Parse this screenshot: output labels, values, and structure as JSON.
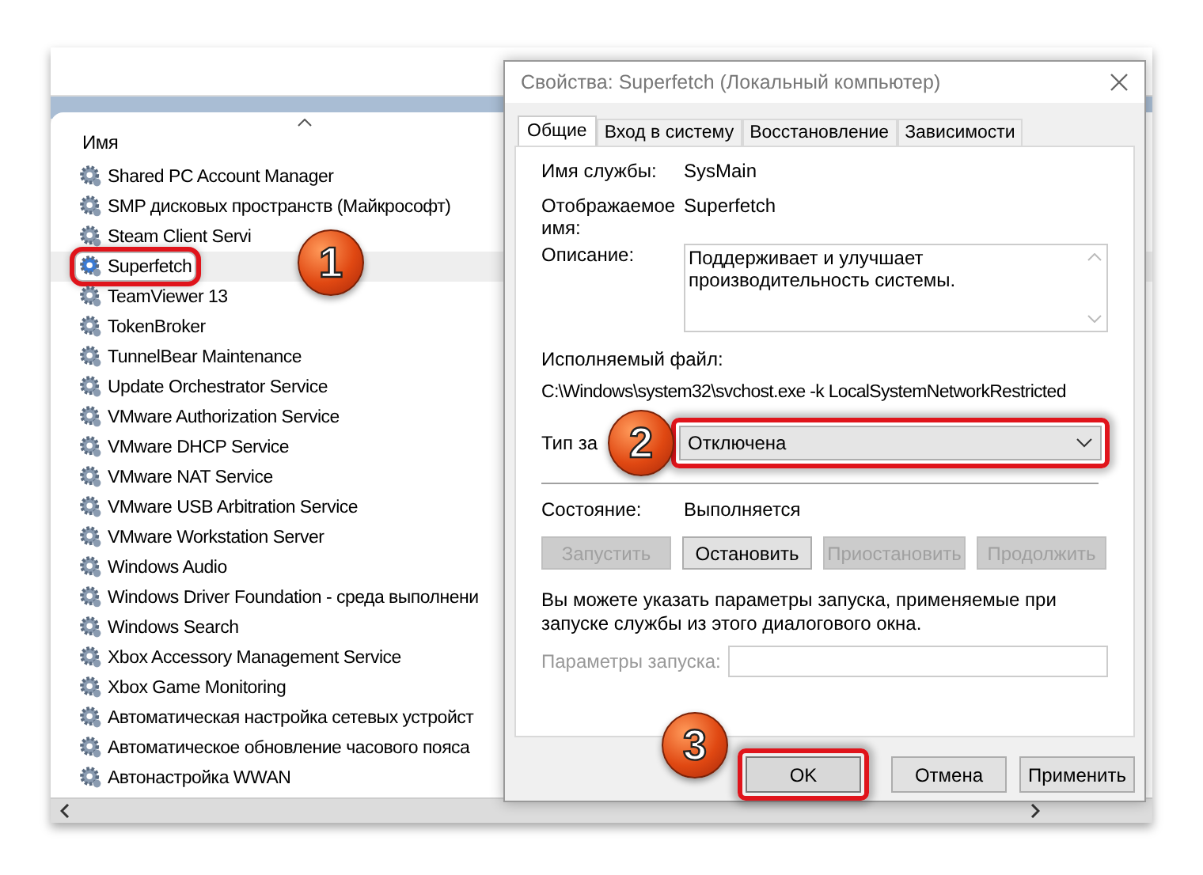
{
  "services_list": {
    "column_header": "Имя",
    "rows": [
      {
        "name": "Shared PC Account Manager",
        "selected": false,
        "highlighted": false
      },
      {
        "name": "SMP дисковых пространств (Майкрософт)",
        "selected": false,
        "highlighted": false
      },
      {
        "name": "Steam Client Servi",
        "selected": false,
        "highlighted": false
      },
      {
        "name": "Superfetch",
        "selected": true,
        "highlighted": true
      },
      {
        "name": "TeamViewer 13",
        "selected": false,
        "highlighted": false
      },
      {
        "name": "TokenBroker",
        "selected": false,
        "highlighted": false
      },
      {
        "name": "TunnelBear Maintenance",
        "selected": false,
        "highlighted": false
      },
      {
        "name": "Update Orchestrator Service",
        "selected": false,
        "highlighted": false
      },
      {
        "name": "VMware Authorization Service",
        "selected": false,
        "highlighted": false
      },
      {
        "name": "VMware DHCP Service",
        "selected": false,
        "highlighted": false
      },
      {
        "name": "VMware NAT Service",
        "selected": false,
        "highlighted": false
      },
      {
        "name": "VMware USB Arbitration Service",
        "selected": false,
        "highlighted": false
      },
      {
        "name": "VMware Workstation Server",
        "selected": false,
        "highlighted": false
      },
      {
        "name": "Windows Audio",
        "selected": false,
        "highlighted": false
      },
      {
        "name": "Windows Driver Foundation - среда выполнени",
        "selected": false,
        "highlighted": false
      },
      {
        "name": "Windows Search",
        "selected": false,
        "highlighted": false
      },
      {
        "name": "Xbox Accessory Management Service",
        "selected": false,
        "highlighted": false
      },
      {
        "name": "Xbox Game Monitoring",
        "selected": false,
        "highlighted": false
      },
      {
        "name": "Автоматическая настройка сетевых устройст",
        "selected": false,
        "highlighted": false
      },
      {
        "name": "Автоматическое обновление часового пояса",
        "selected": false,
        "highlighted": false
      },
      {
        "name": "Автонастройка WWAN",
        "selected": false,
        "highlighted": false
      }
    ]
  },
  "dialog": {
    "title": "Свойства: Superfetch (Локальный компьютер)",
    "tabs": [
      {
        "label": "Общие",
        "selected": true
      },
      {
        "label": "Вход в систему",
        "selected": false
      },
      {
        "label": "Восстановление",
        "selected": false
      },
      {
        "label": "Зависимости",
        "selected": false
      }
    ],
    "service_name_label": "Имя службы:",
    "service_name": "SysMain",
    "display_name_label": "Отображаемое имя:",
    "display_name": "Superfetch",
    "description_label": "Описание:",
    "description": "Поддерживает и улучшает производительность системы.",
    "executable_label": "Исполняемый файл:",
    "executable_path": "C:\\Windows\\system32\\svchost.exe -k LocalSystemNetworkRestricted",
    "startup_type_label": "Тип за",
    "startup_type": "Отключена",
    "startup_highlighted": true,
    "status_label": "Состояние:",
    "status": "Выполняется",
    "service_buttons": [
      {
        "label": "Запустить",
        "disabled": true
      },
      {
        "label": "Остановить",
        "disabled": false
      },
      {
        "label": "Приостановить",
        "disabled": true
      },
      {
        "label": "Продолжить",
        "disabled": true
      }
    ],
    "hint": "Вы можете указать параметры запуска, применяемые при запуске службы из этого диалогового окна.",
    "start_params_label": "Параметры запуска:",
    "start_params_disabled": true,
    "footer_buttons": [
      {
        "label": "OK",
        "highlighted": true
      },
      {
        "label": "Отмена",
        "highlighted": false
      },
      {
        "label": "Применить",
        "highlighted": false
      }
    ]
  },
  "callouts": [
    {
      "number": "1"
    },
    {
      "number": "2"
    },
    {
      "number": "3"
    }
  ]
}
